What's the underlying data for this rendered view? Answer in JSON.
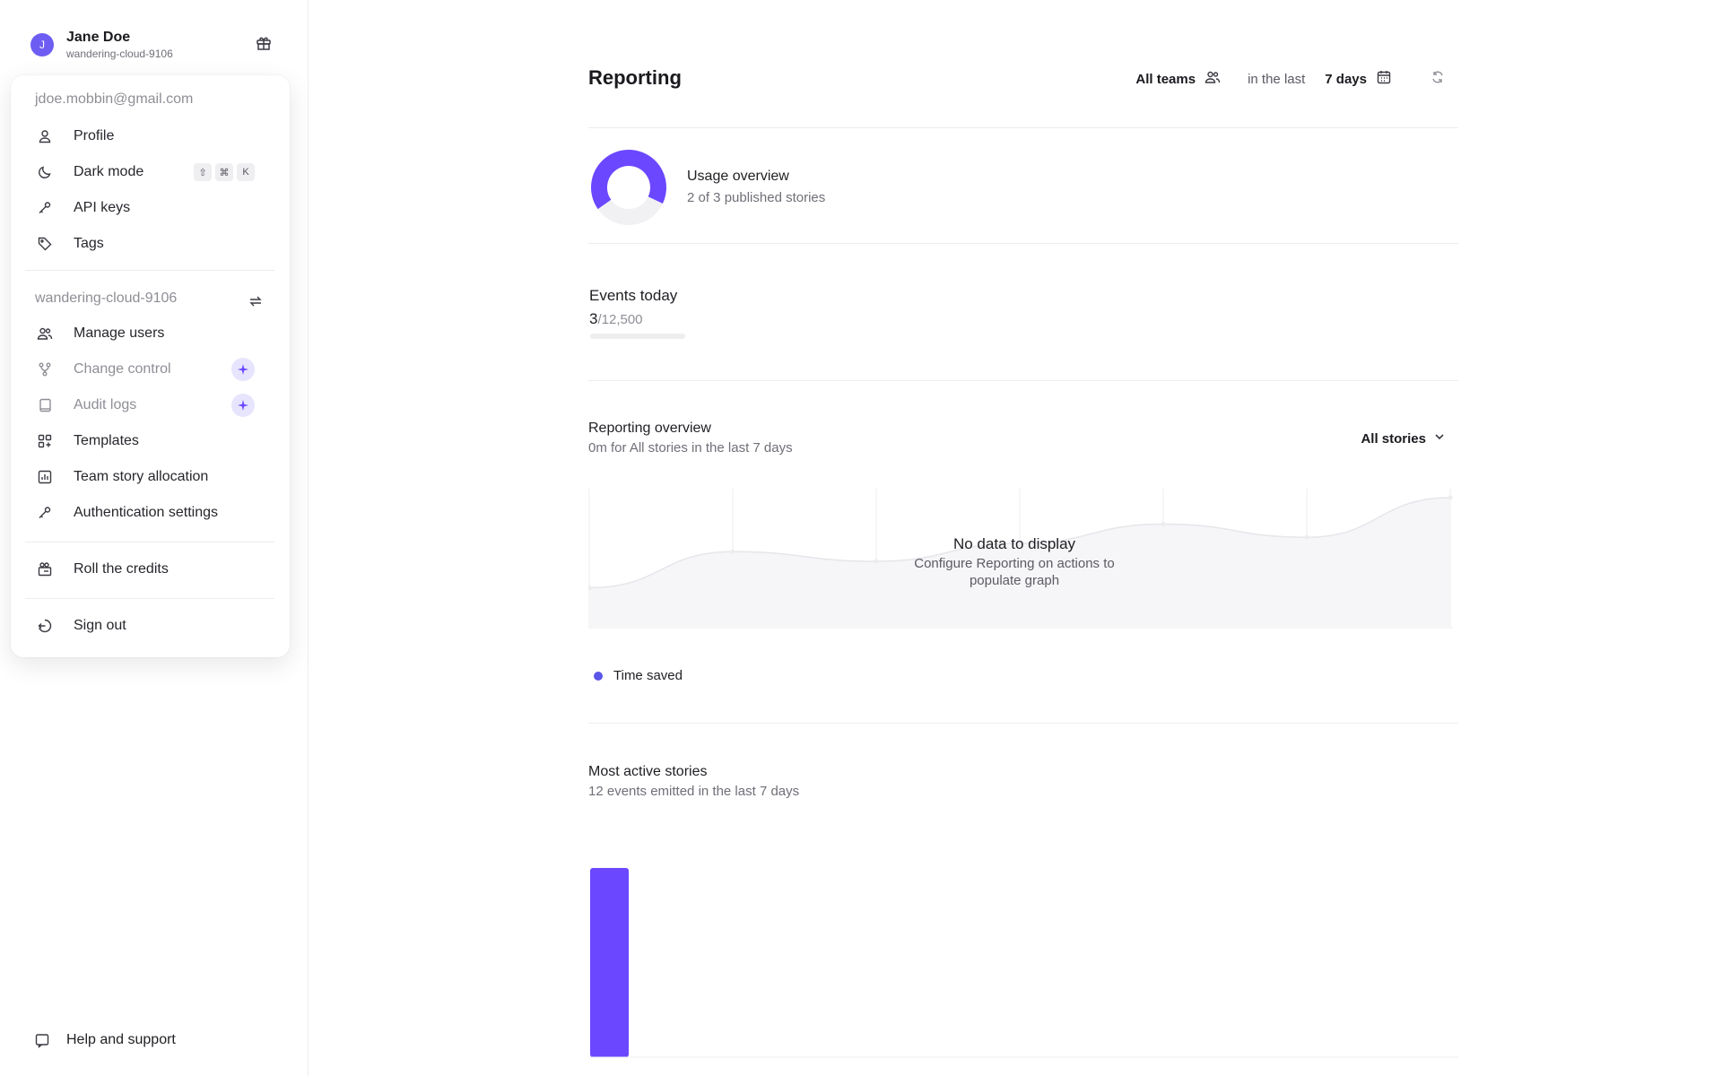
{
  "user": {
    "initial": "J",
    "name": "Jane Doe",
    "tenant": "wandering-cloud-9106"
  },
  "menu": {
    "email": "jdoe.mobbin@gmail.com",
    "account_items": [
      {
        "label": "Profile",
        "icon": "user-icon"
      },
      {
        "label": "Dark mode",
        "icon": "moon-icon",
        "shortcut": [
          "⇧",
          "⌘",
          "K"
        ]
      },
      {
        "label": "API keys",
        "icon": "key-icon"
      },
      {
        "label": "Tags",
        "icon": "tag-icon"
      }
    ],
    "tenant_section": "wandering-cloud-9106",
    "tenant_items": [
      {
        "label": "Manage users",
        "icon": "users-icon"
      },
      {
        "label": "Change control",
        "icon": "git-branch-icon",
        "premium": true
      },
      {
        "label": "Audit logs",
        "icon": "book-icon",
        "premium": true
      },
      {
        "label": "Templates",
        "icon": "grid-plus-icon"
      },
      {
        "label": "Team story allocation",
        "icon": "bar-chart-icon"
      },
      {
        "label": "Authentication settings",
        "icon": "key-icon"
      }
    ],
    "credits": "Roll the credits",
    "sign_out": "Sign out"
  },
  "help": "Help and support",
  "header": {
    "title": "Reporting",
    "teams": "All teams",
    "in_the_last": "in the last",
    "period": "7 days"
  },
  "usage": {
    "title": "Usage overview",
    "subtitle": "2 of 3 published stories",
    "fraction": 0.6667
  },
  "events": {
    "title": "Events today",
    "count": "3",
    "limit": "/12,500",
    "fraction": 0.00024
  },
  "reporting_overview": {
    "title": "Reporting overview",
    "subtitle": "0m for All stories in the last 7 days",
    "filter": "All stories",
    "empty_title": "No data to display",
    "empty_subtitle": "Configure Reporting on actions to populate graph",
    "legend": "Time saved"
  },
  "most_active": {
    "title": "Most active stories",
    "subtitle": "12 events emitted in the last 7 days"
  },
  "colors": {
    "accent": "#6b47ff",
    "legend_dot": "#5a55e8",
    "premium_bg": "#e7e4fd"
  },
  "chart_data": [
    {
      "type": "area",
      "title": "Reporting overview",
      "note": "placeholder shape shown behind empty state",
      "x": [
        0,
        1,
        2,
        3,
        4,
        5,
        6
      ],
      "series": [
        {
          "values": [
            0.25,
            0.55,
            0.47,
            0.62,
            0.78,
            0.67,
            1.0
          ]
        }
      ]
    },
    {
      "type": "bar",
      "title": "Most active stories",
      "categories": [
        ""
      ],
      "values": [
        12
      ]
    }
  ]
}
